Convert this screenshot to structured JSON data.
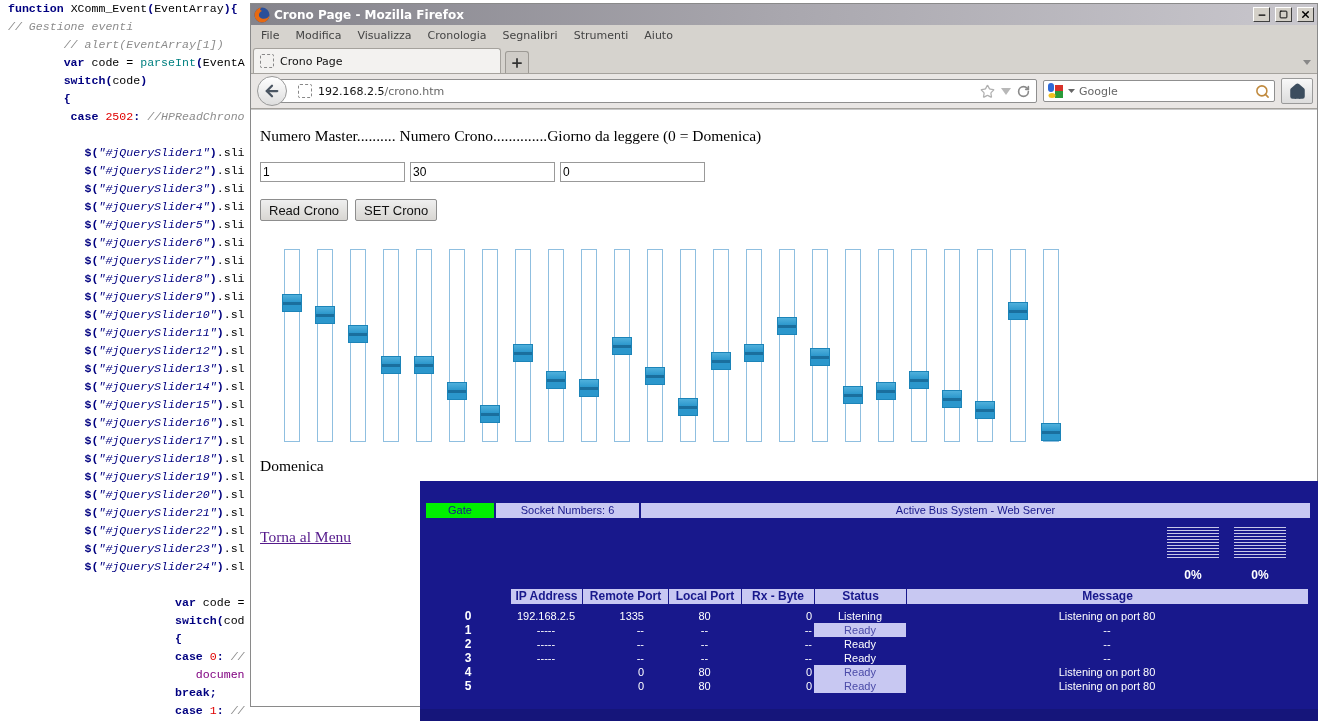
{
  "editor": {
    "lines": [
      {
        "kind": "code",
        "tokens": [
          {
            "kind": "keyword",
            "text": "function"
          },
          {
            "kind": "plain",
            "text": " XComm_Event"
          },
          {
            "kind": "punct",
            "text": "("
          },
          {
            "kind": "plain",
            "text": "EventArray"
          },
          {
            "kind": "punct",
            "text": "){"
          }
        ]
      },
      {
        "kind": "code",
        "tokens": [
          {
            "kind": "comment",
            "text": "// Gestione eventi"
          }
        ]
      },
      {
        "kind": "code",
        "tokens": [
          {
            "kind": "comment",
            "text": "        // alert(EventArray[1])"
          }
        ]
      },
      {
        "kind": "code",
        "tokens": [
          {
            "kind": "keyword",
            "text": "        var"
          },
          {
            "kind": "plain",
            "text": " code = "
          },
          {
            "kind": "func",
            "text": "parseInt"
          },
          {
            "kind": "punct",
            "text": "("
          },
          {
            "kind": "plain",
            "text": "EventA"
          }
        ]
      },
      {
        "kind": "code",
        "tokens": [
          {
            "kind": "keyword",
            "text": "        switch"
          },
          {
            "kind": "punct",
            "text": "("
          },
          {
            "kind": "plain",
            "text": "code"
          },
          {
            "kind": "punct",
            "text": ")"
          }
        ]
      },
      {
        "kind": "code",
        "tokens": [
          {
            "kind": "punct",
            "text": "        {"
          }
        ]
      },
      {
        "kind": "code",
        "tokens": [
          {
            "kind": "keyword",
            "text": "         case"
          },
          {
            "kind": "number",
            "text": " 2502"
          },
          {
            "kind": "punct",
            "text": ":"
          },
          {
            "kind": "comment",
            "text": " //HPReadChrono"
          }
        ]
      },
      {
        "kind": "blank"
      },
      {
        "kind": "code",
        "tokens": [
          {
            "kind": "punct",
            "text": "           $("
          },
          {
            "kind": "string",
            "text": "\"#jQuerySlider1\""
          },
          {
            "kind": "punct",
            "text": ")"
          },
          {
            "kind": "plain",
            "text": ".sli"
          }
        ]
      },
      {
        "kind": "code",
        "tokens": [
          {
            "kind": "punct",
            "text": "           $("
          },
          {
            "kind": "string",
            "text": "\"#jQuerySlider2\""
          },
          {
            "kind": "punct",
            "text": ")"
          },
          {
            "kind": "plain",
            "text": ".sli"
          }
        ]
      },
      {
        "kind": "code",
        "tokens": [
          {
            "kind": "punct",
            "text": "           $("
          },
          {
            "kind": "string",
            "text": "\"#jQuerySlider3\""
          },
          {
            "kind": "punct",
            "text": ")"
          },
          {
            "kind": "plain",
            "text": ".sli"
          }
        ]
      },
      {
        "kind": "code",
        "tokens": [
          {
            "kind": "punct",
            "text": "           $("
          },
          {
            "kind": "string",
            "text": "\"#jQuerySlider4\""
          },
          {
            "kind": "punct",
            "text": ")"
          },
          {
            "kind": "plain",
            "text": ".sli"
          }
        ]
      },
      {
        "kind": "code",
        "tokens": [
          {
            "kind": "punct",
            "text": "           $("
          },
          {
            "kind": "string",
            "text": "\"#jQuerySlider5\""
          },
          {
            "kind": "punct",
            "text": ")"
          },
          {
            "kind": "plain",
            "text": ".sli"
          }
        ]
      },
      {
        "kind": "code",
        "tokens": [
          {
            "kind": "punct",
            "text": "           $("
          },
          {
            "kind": "string",
            "text": "\"#jQuerySlider6\""
          },
          {
            "kind": "punct",
            "text": ")"
          },
          {
            "kind": "plain",
            "text": ".sli"
          }
        ]
      },
      {
        "kind": "code",
        "tokens": [
          {
            "kind": "punct",
            "text": "           $("
          },
          {
            "kind": "string",
            "text": "\"#jQuerySlider7\""
          },
          {
            "kind": "punct",
            "text": ")"
          },
          {
            "kind": "plain",
            "text": ".sli"
          }
        ]
      },
      {
        "kind": "code",
        "tokens": [
          {
            "kind": "punct",
            "text": "           $("
          },
          {
            "kind": "string",
            "text": "\"#jQuerySlider8\""
          },
          {
            "kind": "punct",
            "text": ")"
          },
          {
            "kind": "plain",
            "text": ".sli"
          }
        ]
      },
      {
        "kind": "code",
        "tokens": [
          {
            "kind": "punct",
            "text": "           $("
          },
          {
            "kind": "string",
            "text": "\"#jQuerySlider9\""
          },
          {
            "kind": "punct",
            "text": ")"
          },
          {
            "kind": "plain",
            "text": ".sli"
          }
        ]
      },
      {
        "kind": "code",
        "tokens": [
          {
            "kind": "punct",
            "text": "           $("
          },
          {
            "kind": "string",
            "text": "\"#jQuerySlider10\""
          },
          {
            "kind": "punct",
            "text": ")"
          },
          {
            "kind": "plain",
            "text": ".sl"
          }
        ]
      },
      {
        "kind": "code",
        "tokens": [
          {
            "kind": "punct",
            "text": "           $("
          },
          {
            "kind": "string",
            "text": "\"#jQuerySlider11\""
          },
          {
            "kind": "punct",
            "text": ")"
          },
          {
            "kind": "plain",
            "text": ".sl"
          }
        ]
      },
      {
        "kind": "code",
        "tokens": [
          {
            "kind": "punct",
            "text": "           $("
          },
          {
            "kind": "string",
            "text": "\"#jQuerySlider12\""
          },
          {
            "kind": "punct",
            "text": ")"
          },
          {
            "kind": "plain",
            "text": ".sl"
          }
        ]
      },
      {
        "kind": "code",
        "tokens": [
          {
            "kind": "punct",
            "text": "           $("
          },
          {
            "kind": "string",
            "text": "\"#jQuerySlider13\""
          },
          {
            "kind": "punct",
            "text": ")"
          },
          {
            "kind": "plain",
            "text": ".sl"
          }
        ]
      },
      {
        "kind": "code",
        "tokens": [
          {
            "kind": "punct",
            "text": "           $("
          },
          {
            "kind": "string",
            "text": "\"#jQuerySlider14\""
          },
          {
            "kind": "punct",
            "text": ")"
          },
          {
            "kind": "plain",
            "text": ".sl"
          }
        ]
      },
      {
        "kind": "code",
        "tokens": [
          {
            "kind": "punct",
            "text": "           $("
          },
          {
            "kind": "string",
            "text": "\"#jQuerySlider15\""
          },
          {
            "kind": "punct",
            "text": ")"
          },
          {
            "kind": "plain",
            "text": ".sl"
          }
        ]
      },
      {
        "kind": "code",
        "tokens": [
          {
            "kind": "punct",
            "text": "           $("
          },
          {
            "kind": "string",
            "text": "\"#jQuerySlider16\""
          },
          {
            "kind": "punct",
            "text": ")"
          },
          {
            "kind": "plain",
            "text": ".sl"
          }
        ]
      },
      {
        "kind": "code",
        "tokens": [
          {
            "kind": "punct",
            "text": "           $("
          },
          {
            "kind": "string",
            "text": "\"#jQuerySlider17\""
          },
          {
            "kind": "punct",
            "text": ")"
          },
          {
            "kind": "plain",
            "text": ".sl"
          }
        ]
      },
      {
        "kind": "code",
        "tokens": [
          {
            "kind": "punct",
            "text": "           $("
          },
          {
            "kind": "string",
            "text": "\"#jQuerySlider18\""
          },
          {
            "kind": "punct",
            "text": ")"
          },
          {
            "kind": "plain",
            "text": ".sl"
          }
        ]
      },
      {
        "kind": "code",
        "tokens": [
          {
            "kind": "punct",
            "text": "           $("
          },
          {
            "kind": "string",
            "text": "\"#jQuerySlider19\""
          },
          {
            "kind": "punct",
            "text": ")"
          },
          {
            "kind": "plain",
            "text": ".sl"
          }
        ]
      },
      {
        "kind": "code",
        "tokens": [
          {
            "kind": "punct",
            "text": "           $("
          },
          {
            "kind": "string",
            "text": "\"#jQuerySlider20\""
          },
          {
            "kind": "punct",
            "text": ")"
          },
          {
            "kind": "plain",
            "text": ".sl"
          }
        ]
      },
      {
        "kind": "code",
        "tokens": [
          {
            "kind": "punct",
            "text": "           $("
          },
          {
            "kind": "string",
            "text": "\"#jQuerySlider21\""
          },
          {
            "kind": "punct",
            "text": ")"
          },
          {
            "kind": "plain",
            "text": ".sl"
          }
        ]
      },
      {
        "kind": "code",
        "tokens": [
          {
            "kind": "punct",
            "text": "           $("
          },
          {
            "kind": "string",
            "text": "\"#jQuerySlider22\""
          },
          {
            "kind": "punct",
            "text": ")"
          },
          {
            "kind": "plain",
            "text": ".sl"
          }
        ]
      },
      {
        "kind": "code",
        "tokens": [
          {
            "kind": "punct",
            "text": "           $("
          },
          {
            "kind": "string",
            "text": "\"#jQuerySlider23\""
          },
          {
            "kind": "punct",
            "text": ")"
          },
          {
            "kind": "plain",
            "text": ".sl"
          }
        ]
      },
      {
        "kind": "code",
        "tokens": [
          {
            "kind": "punct",
            "text": "           $("
          },
          {
            "kind": "string",
            "text": "\"#jQuerySlider24\""
          },
          {
            "kind": "punct",
            "text": ")"
          },
          {
            "kind": "plain",
            "text": ".sl"
          }
        ]
      },
      {
        "kind": "blank"
      },
      {
        "kind": "code",
        "tokens": [
          {
            "kind": "keyword",
            "text": "                        var"
          },
          {
            "kind": "plain",
            "text": " code ="
          }
        ]
      },
      {
        "kind": "code",
        "tokens": [
          {
            "kind": "keyword",
            "text": "                        switch"
          },
          {
            "kind": "punct",
            "text": "("
          },
          {
            "kind": "plain",
            "text": "cod"
          }
        ]
      },
      {
        "kind": "code",
        "tokens": [
          {
            "kind": "punct",
            "text": "                        {"
          }
        ]
      },
      {
        "kind": "code",
        "tokens": [
          {
            "kind": "keyword",
            "text": "                        case"
          },
          {
            "kind": "number",
            "text": " 0"
          },
          {
            "kind": "punct",
            "text": ":"
          },
          {
            "kind": "comment",
            "text": " //"
          }
        ]
      },
      {
        "kind": "code",
        "tokens": [
          {
            "kind": "member",
            "text": "                           documen"
          }
        ]
      },
      {
        "kind": "code",
        "tokens": [
          {
            "kind": "keyword",
            "text": "                        break"
          },
          {
            "kind": "punct",
            "text": ";"
          }
        ]
      },
      {
        "kind": "code",
        "tokens": [
          {
            "kind": "keyword",
            "text": "                        case"
          },
          {
            "kind": "number",
            "text": " 1"
          },
          {
            "kind": "punct",
            "text": ":"
          },
          {
            "kind": "comment",
            "text": " //"
          }
        ]
      }
    ]
  },
  "browser": {
    "title": "Crono Page - Mozilla Firefox",
    "menu": [
      "File",
      "Modifica",
      "Visualizza",
      "Cronologia",
      "Segnalibri",
      "Strumenti",
      "Aiuto"
    ],
    "tabs": [
      {
        "label": "Crono Page",
        "selected": true
      }
    ],
    "address": {
      "host": "192.168.2.5",
      "path": "/crono.htm"
    },
    "search": {
      "placeholder": "Google"
    }
  },
  "page": {
    "heading": "Numero Master.......... Numero Crono..............Giorno da leggere (0 = Domenica)",
    "fields": [
      {
        "value": "1"
      },
      {
        "value": "30"
      },
      {
        "value": "0"
      }
    ],
    "buttons": [
      "Read Crono",
      "SET Crono"
    ],
    "sliders": [
      {
        "level": 0.72
      },
      {
        "level": 0.66
      },
      {
        "level": 0.56
      },
      {
        "level": 0.4
      },
      {
        "level": 0.4
      },
      {
        "level": 0.26
      },
      {
        "level": 0.14
      },
      {
        "level": 0.46
      },
      {
        "level": 0.32
      },
      {
        "level": 0.28
      },
      {
        "level": 0.5
      },
      {
        "level": 0.34
      },
      {
        "level": 0.18
      },
      {
        "level": 0.42
      },
      {
        "level": 0.46
      },
      {
        "level": 0.6
      },
      {
        "level": 0.44
      },
      {
        "level": 0.24
      },
      {
        "level": 0.26
      },
      {
        "level": 0.32
      },
      {
        "level": 0.22
      },
      {
        "level": 0.16
      },
      {
        "level": 0.68
      },
      {
        "level": 0.04
      }
    ],
    "day": "Domenica",
    "link": "Torna al Menu"
  },
  "server": {
    "gate": {
      "label": "Gate",
      "active": true
    },
    "sockets": "Socket Numbers: 6",
    "title": "Active Bus System - Web Server",
    "meters": [
      {
        "reading": "0%"
      },
      {
        "reading": "0%"
      }
    ],
    "columns": [
      "IP Address",
      "Remote Port",
      "Local Port",
      "Rx - Byte",
      "Status",
      "Message"
    ],
    "rows": [
      {
        "index": "0",
        "ip": "192.168.2.5",
        "remote_port": "1335",
        "local_port": "80",
        "rx_byte": "0",
        "status": "Listening",
        "highlighted": false,
        "message": "Listening on port 80"
      },
      {
        "index": "1",
        "ip": "-----",
        "remote_port": "--",
        "local_port": "--",
        "rx_byte": "--",
        "status": "Ready",
        "highlighted": true,
        "message": "--"
      },
      {
        "index": "2",
        "ip": "-----",
        "remote_port": "--",
        "local_port": "--",
        "rx_byte": "--",
        "status": "Ready",
        "highlighted": false,
        "message": "--"
      },
      {
        "index": "3",
        "ip": "-----",
        "remote_port": "--",
        "local_port": "--",
        "rx_byte": "--",
        "status": "Ready",
        "highlighted": false,
        "message": "--"
      },
      {
        "index": "4",
        "remote_port": "0",
        "local_port": "80",
        "rx_byte": "0",
        "status": "Ready",
        "highlighted": true,
        "message": "Listening on port 80"
      },
      {
        "index": "5",
        "remote_port": "0",
        "local_port": "80",
        "rx_byte": "0",
        "status": "Ready",
        "highlighted": true,
        "message": "Listening on port 80"
      }
    ]
  }
}
